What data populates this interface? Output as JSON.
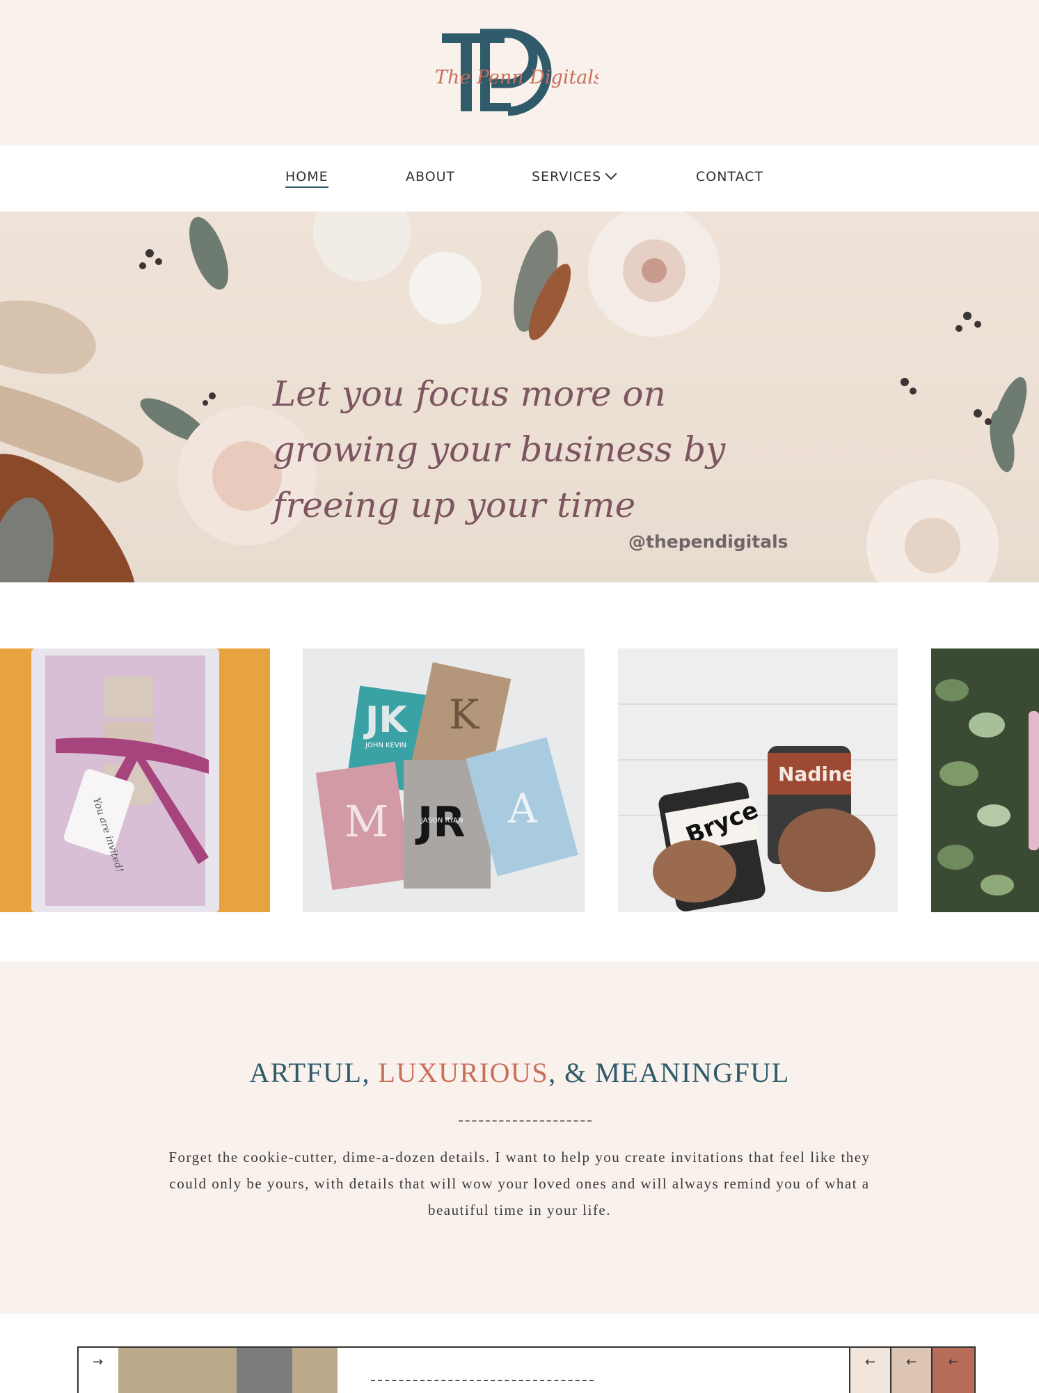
{
  "header": {
    "logo_monogram": "TPD",
    "logo_script": "The Penn Digitals"
  },
  "nav": {
    "items": [
      {
        "label": "HOME",
        "active": true
      },
      {
        "label": "ABOUT"
      },
      {
        "label": "SERVICES",
        "has_dropdown": true
      },
      {
        "label": "CONTACT"
      }
    ]
  },
  "hero": {
    "tagline": "Let you focus more on growing your business by freeing up your time",
    "handle": "@thependigitals"
  },
  "gallery": {
    "images": [
      {
        "subject": "invitation with pink ribbon",
        "tag_text": "You are invited!"
      },
      {
        "subject": "personalized notebooks",
        "labels": [
          "JK",
          "K",
          "M",
          "JR",
          "A",
          "JOHN KEVIN",
          "JASON RYAN"
        ]
      },
      {
        "subject": "personalized tumblers",
        "labels": [
          "Bryce",
          "Nadine"
        ]
      },
      {
        "subject": "greenery"
      }
    ]
  },
  "intro": {
    "heading_part1": "ARTFUL,",
    "heading_accent": "LUXURIOUS",
    "heading_part2": ", & MEANINGFUL",
    "body": "Forget the cookie-cutter, dime-a-dozen details. I want to help you create invitations that feel like they could only be yours, with details that will wow your loved ones and will always remind you of what a beautiful time in your life."
  },
  "slider": {
    "next_icon": "→",
    "prev_icon": "←"
  },
  "colors": {
    "blush_bg": "#f9f1ec",
    "teal": "#2f5b6a",
    "terracotta": "#c96e5a",
    "mauve": "#7d5560"
  }
}
